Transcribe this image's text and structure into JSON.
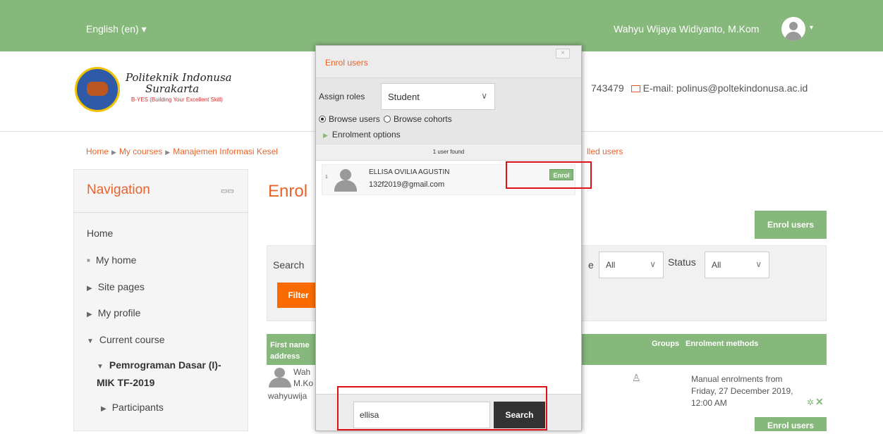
{
  "topbar": {
    "language": "English (en)",
    "username": "Wahyu Wijaya Widiyanto, M.Kom",
    "caret": "▾"
  },
  "header": {
    "logo_name_line1": "Politeknik Indonusa",
    "logo_name_line2": "Surakarta",
    "logo_tagline": "B-YES (Building Your Excellent Skill)",
    "contact_fragment": "743479",
    "email_label": "E-mail: polinus@poltekindonusa.ac.id"
  },
  "breadcrumb": {
    "home": "Home",
    "my_courses": "My courses",
    "course": "Manajemen Informasi Kesel",
    "tail": "lled users"
  },
  "navigation": {
    "title": "Navigation",
    "controls": "▭▭",
    "home": "Home",
    "my_home": "My home",
    "site_pages": "Site pages",
    "my_profile": "My profile",
    "current_course": "Current course",
    "course_name_line1": "Pemrograman Dasar (I)-",
    "course_name_line2": "MIK TF-2019",
    "participants": "Participants"
  },
  "main": {
    "page_title_fragment": "Enrol",
    "enrol_users_button": "Enrol users",
    "enrol_users_button_bottom": "Enrol users",
    "search_label": "Search",
    "role_label_fragment": "e",
    "role_select_value": "All",
    "status_label": "Status",
    "status_select_value": "All",
    "filter_button": "Filter",
    "table_headers": {
      "first_name_line1": "First name",
      "first_name_line2": "address",
      "groups": "Groups",
      "enrolment_methods": "Enrolment methods"
    },
    "row": {
      "name_line1": "Wah",
      "name_line2": "M.Ko",
      "email_fragment": "wahyuwija",
      "enrolment_line1": "Manual enrolments from",
      "enrolment_line2": "Friday, 27 December 2019,",
      "enrolment_line3": "12:00 AM"
    }
  },
  "modal": {
    "title": "Enrol users",
    "close": "×",
    "assign_roles_label": "Assign roles",
    "role_value": "Student",
    "browse_users": "Browse users",
    "browse_cohorts": "Browse cohorts",
    "enrolment_options": "Enrolment options",
    "users_found": "1 user found",
    "result": {
      "index": "1",
      "name": "ELLISA OVILIA AGUSTIN",
      "email": "132f2019@gmail.com",
      "enrol_button": "Enrol"
    },
    "search_value": "ellisa",
    "search_button": "Search"
  },
  "colors": {
    "brand_green": "#86b77b",
    "accent_orange": "#e8642c",
    "filter_orange": "#f96b00",
    "highlight_red": "#e0101a"
  }
}
